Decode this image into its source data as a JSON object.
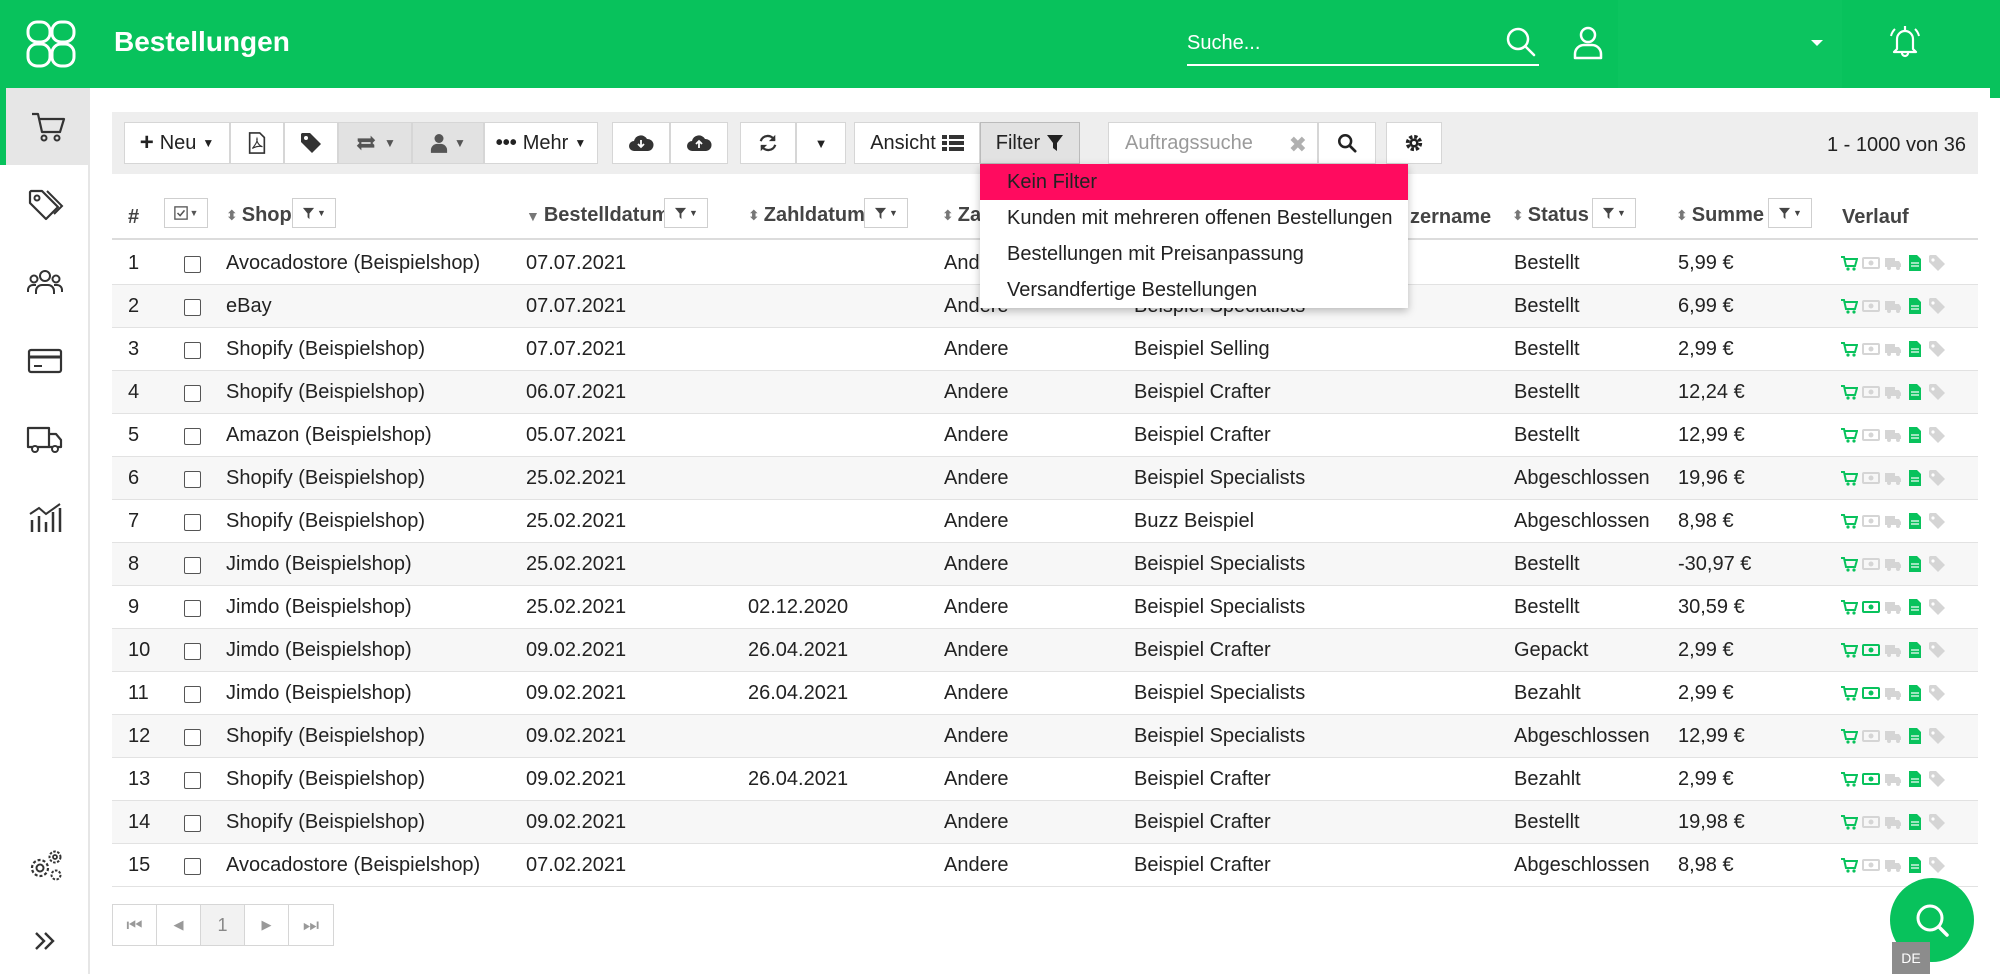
{
  "header": {
    "title": "Bestellungen",
    "search_placeholder": "Suche...",
    "colors": {
      "brand": "#08c25c",
      "highlight": "#ff0b5f"
    }
  },
  "sidebar": {
    "items": [
      {
        "icon": "cart-icon",
        "active": true
      },
      {
        "icon": "tags-icon",
        "active": false
      },
      {
        "icon": "users-icon",
        "active": false
      },
      {
        "icon": "credit-card-icon",
        "active": false
      },
      {
        "icon": "truck-icon",
        "active": false
      },
      {
        "icon": "chart-icon",
        "active": false
      },
      {
        "icon": "settings-icon",
        "active": false
      },
      {
        "icon": "expand-icon",
        "active": false
      }
    ]
  },
  "toolbar": {
    "new_label": "Neu",
    "more_label": "Mehr",
    "view_label": "Ansicht",
    "filter_label": "Filter",
    "order_search_placeholder": "Auftragssuche",
    "count_text": "1 - 1000 von 36"
  },
  "filter_menu": {
    "items": [
      "Kein Filter",
      "Kunden mit mehreren offenen Bestellungen",
      "Bestellungen mit Preisanpassung",
      "Versandfertige Bestellungen"
    ],
    "selected_index": 0
  },
  "table": {
    "columns": {
      "num": "#",
      "shop": "Shop",
      "order_date": "Bestelldatum",
      "pay_date": "Zahldatum",
      "payment": "Za",
      "username": "zername",
      "status": "Status",
      "sum": "Summe",
      "history": "Verlauf"
    },
    "rows": [
      {
        "n": "1",
        "shop": "Avocadostore (Beispielshop)",
        "order_date": "07.07.2021",
        "pay_date": "",
        "payment": "And",
        "user": "",
        "status": "Bestellt",
        "sum": "5,99 €",
        "paid": false
      },
      {
        "n": "2",
        "shop": "eBay",
        "order_date": "07.07.2021",
        "pay_date": "",
        "payment": "Andere",
        "user": "Beispiel Specialists",
        "status": "Bestellt",
        "sum": "6,99 €",
        "paid": false
      },
      {
        "n": "3",
        "shop": "Shopify (Beispielshop)",
        "order_date": "07.07.2021",
        "pay_date": "",
        "payment": "Andere",
        "user": "Beispiel Selling",
        "status": "Bestellt",
        "sum": "2,99 €",
        "paid": false
      },
      {
        "n": "4",
        "shop": "Shopify (Beispielshop)",
        "order_date": "06.07.2021",
        "pay_date": "",
        "payment": "Andere",
        "user": "Beispiel Crafter",
        "status": "Bestellt",
        "sum": "12,24 €",
        "paid": false
      },
      {
        "n": "5",
        "shop": "Amazon (Beispielshop)",
        "order_date": "05.07.2021",
        "pay_date": "",
        "payment": "Andere",
        "user": "Beispiel Crafter",
        "status": "Bestellt",
        "sum": "12,99 €",
        "paid": false
      },
      {
        "n": "6",
        "shop": "Shopify (Beispielshop)",
        "order_date": "25.02.2021",
        "pay_date": "",
        "payment": "Andere",
        "user": "Beispiel Specialists",
        "status": "Abgeschlossen",
        "sum": "19,96 €",
        "paid": false
      },
      {
        "n": "7",
        "shop": "Shopify (Beispielshop)",
        "order_date": "25.02.2021",
        "pay_date": "",
        "payment": "Andere",
        "user": "Buzz Beispiel",
        "status": "Abgeschlossen",
        "sum": "8,98 €",
        "paid": false
      },
      {
        "n": "8",
        "shop": "Jimdo (Beispielshop)",
        "order_date": "25.02.2021",
        "pay_date": "",
        "payment": "Andere",
        "user": "Beispiel Specialists",
        "status": "Bestellt",
        "sum": "-30,97 €",
        "paid": false
      },
      {
        "n": "9",
        "shop": "Jimdo (Beispielshop)",
        "order_date": "25.02.2021",
        "pay_date": "02.12.2020",
        "payment": "Andere",
        "user": "Beispiel Specialists",
        "status": "Bestellt",
        "sum": "30,59 €",
        "paid": true
      },
      {
        "n": "10",
        "shop": "Jimdo (Beispielshop)",
        "order_date": "09.02.2021",
        "pay_date": "26.04.2021",
        "payment": "Andere",
        "user": "Beispiel Crafter",
        "status": "Gepackt",
        "sum": "2,99 €",
        "paid": true
      },
      {
        "n": "11",
        "shop": "Jimdo (Beispielshop)",
        "order_date": "09.02.2021",
        "pay_date": "26.04.2021",
        "payment": "Andere",
        "user": "Beispiel Specialists",
        "status": "Bezahlt",
        "sum": "2,99 €",
        "paid": true
      },
      {
        "n": "12",
        "shop": "Shopify (Beispielshop)",
        "order_date": "09.02.2021",
        "pay_date": "",
        "payment": "Andere",
        "user": "Beispiel Specialists",
        "status": "Abgeschlossen",
        "sum": "12,99 €",
        "paid": false
      },
      {
        "n": "13",
        "shop": "Shopify (Beispielshop)",
        "order_date": "09.02.2021",
        "pay_date": "26.04.2021",
        "payment": "Andere",
        "user": "Beispiel Crafter",
        "status": "Bezahlt",
        "sum": "2,99 €",
        "paid": true
      },
      {
        "n": "14",
        "shop": "Shopify (Beispielshop)",
        "order_date": "09.02.2021",
        "pay_date": "",
        "payment": "Andere",
        "user": "Beispiel Crafter",
        "status": "Bestellt",
        "sum": "19,98 €",
        "paid": false
      },
      {
        "n": "15",
        "shop": "Avocadostore (Beispielshop)",
        "order_date": "07.02.2021",
        "pay_date": "",
        "payment": "Andere",
        "user": "Beispiel Crafter",
        "status": "Abgeschlossen",
        "sum": "8,98 €",
        "paid": false
      }
    ]
  },
  "pager": {
    "current": "1"
  },
  "language_badge": "DE"
}
